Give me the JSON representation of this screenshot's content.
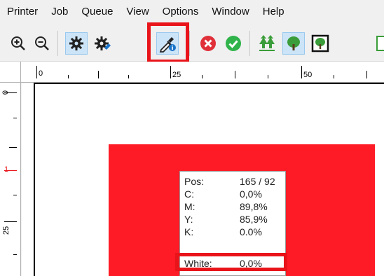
{
  "menubar": {
    "items": [
      "Printer",
      "Job",
      "Queue",
      "View",
      "Options",
      "Window",
      "Help"
    ]
  },
  "toolbar": {
    "buttons": [
      {
        "icon": "zoom-in-icon",
        "pressed": false
      },
      {
        "icon": "zoom-out-icon",
        "pressed": false
      },
      {
        "icon": "settings-gear-icon",
        "pressed": true
      },
      {
        "icon": "gear-tool-icon",
        "pressed": false
      },
      {
        "icon": "color-picker-icon",
        "pressed": true,
        "highlighted": true
      },
      {
        "icon": "cancel-icon",
        "pressed": false
      },
      {
        "icon": "confirm-icon",
        "pressed": false
      },
      {
        "icon": "tile-view-icon",
        "pressed": false
      },
      {
        "icon": "tree-view-icon",
        "pressed": true
      },
      {
        "icon": "tree-frame-icon",
        "pressed": false
      },
      {
        "icon": "tree-partial-icon",
        "pressed": false
      }
    ],
    "colors": {
      "accent_green": "#3a9d3a",
      "cancel_red": "#e0303a",
      "confirm_green": "#2fb34a",
      "picker_blue": "#1a74c9",
      "highlight": "#e8141a"
    }
  },
  "ruler_top": {
    "labels": [
      "0",
      "25",
      "50"
    ]
  },
  "ruler_left": {
    "labels": [
      "0",
      "1",
      "25"
    ]
  },
  "canvas": {
    "image_color": "#ff1b25"
  },
  "info": {
    "pos_label": "Pos:",
    "pos_value": "165 / 92",
    "c_label": "C:",
    "c_value": "0,0%",
    "m_label": "M:",
    "m_value": "89,8%",
    "y_label": "Y:",
    "y_value": "85,9%",
    "k_label": "K:",
    "k_value": "0,0%",
    "white_label": "White:",
    "white_value": "0,0%"
  }
}
